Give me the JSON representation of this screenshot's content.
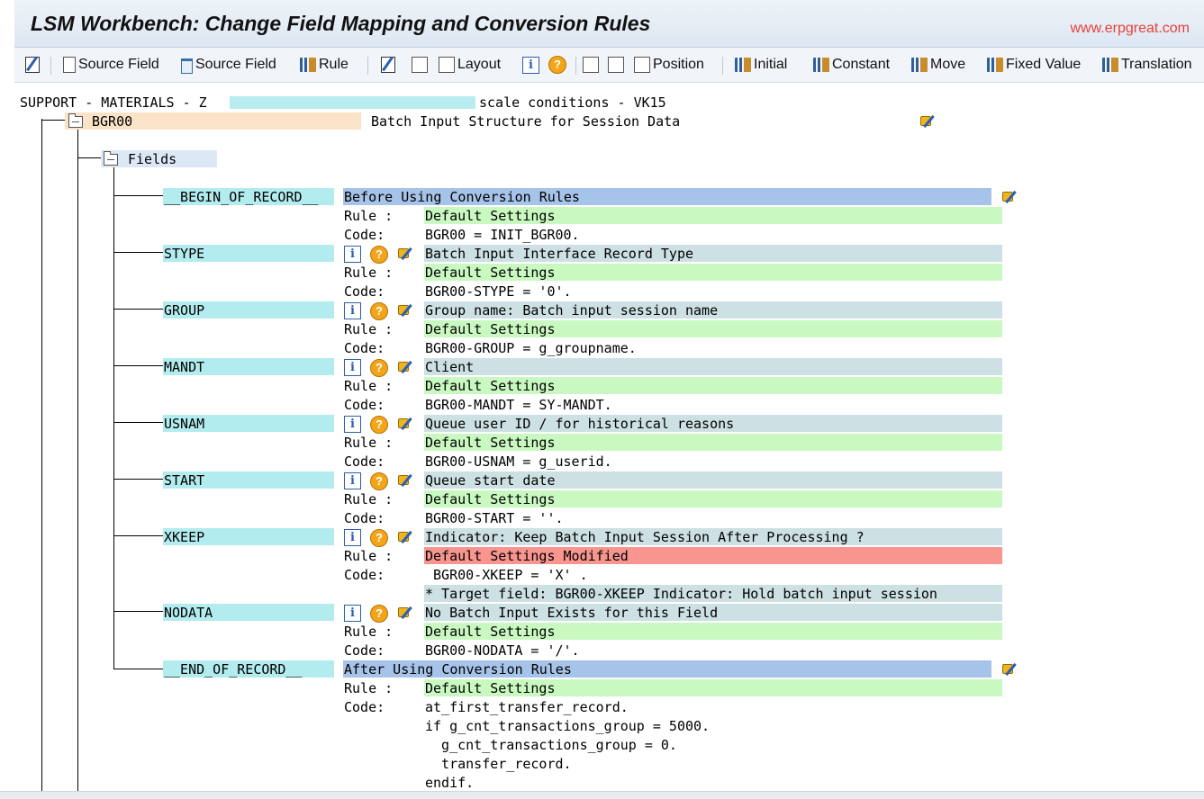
{
  "window": {
    "title": "LSM Workbench: Change Field Mapping and Conversion Rules",
    "watermark": "www.erpgreat.com"
  },
  "toolbar": {
    "source_field_1": "Source Field",
    "source_field_2": "Source Field",
    "rule": "Rule",
    "layout": "Layout",
    "position": "Position",
    "initial": "Initial",
    "constant": "Constant",
    "move": "Move",
    "fixed_value": "Fixed Value",
    "translation": "Translation"
  },
  "tree": {
    "root_prefix": "SUPPORT - MATERIALS - Z",
    "root_suffix": "scale conditions - VK15",
    "structure_name": "BGR00",
    "structure_desc": "Batch Input Structure for Session Data",
    "fields_label": "Fields",
    "rule_label": "Rule :",
    "code_label": "Code:",
    "info_glyph": "i",
    "help_glyph": "?",
    "begin_name": "__BEGIN_OF_RECORD__",
    "begin_desc": "Before Using Conversion Rules",
    "begin_rule": "Default Settings",
    "begin_code": "BGR00 = INIT_BGR00.",
    "fields": [
      {
        "name": "STYPE",
        "desc": "Batch Input Interface Record Type",
        "rule": "Default Settings",
        "code": "BGR00-STYPE = '0'."
      },
      {
        "name": "GROUP",
        "desc": "Group name: Batch input session name",
        "rule": "Default Settings",
        "code": "BGR00-GROUP = g_groupname."
      },
      {
        "name": "MANDT",
        "desc": "Client",
        "rule": "Default Settings",
        "code": "BGR00-MANDT = SY-MANDT."
      },
      {
        "name": "USNAM",
        "desc": "Queue user ID / for historical reasons",
        "rule": "Default Settings",
        "code": "BGR00-USNAM = g_userid."
      },
      {
        "name": "START",
        "desc": "Queue start date",
        "rule": "Default Settings",
        "code": "BGR00-START = ''."
      },
      {
        "name": "XKEEP",
        "desc": "Indicator: Keep Batch Input Session After Processing ?",
        "rule": "Default Settings Modified",
        "code": " BGR00-XKEEP = 'X' .",
        "comment": "* Target field: BGR00-XKEEP Indicator: Hold batch input session"
      },
      {
        "name": "NODATA",
        "desc": "No Batch Input Exists for this Field",
        "rule": "Default Settings",
        "code": "BGR00-NODATA = '/'."
      }
    ],
    "end_name": "__END_OF_RECORD__",
    "end_desc": "After Using Conversion Rules",
    "end_rule": "Default Settings",
    "end_code": [
      "at_first_transfer_record.",
      "if g_cnt_transactions_group = 5000.",
      "  g_cnt_transactions_group = 0.",
      "  transfer_record.",
      "endif."
    ]
  }
}
